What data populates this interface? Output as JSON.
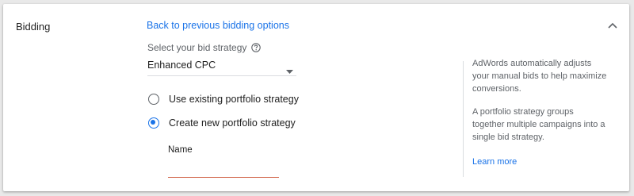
{
  "section": {
    "title": "Bidding"
  },
  "back_link": "Back to previous bidding options",
  "bid_strategy": {
    "label": "Select your bid strategy",
    "selected": "Enhanced CPC"
  },
  "portfolio_options": [
    {
      "label": "Use existing portfolio strategy",
      "checked": false
    },
    {
      "label": "Create new portfolio strategy",
      "checked": true
    }
  ],
  "name_field": {
    "label": "Name",
    "value": ""
  },
  "side_help": {
    "paragraph1": "AdWords automatically adjusts your manual bids to help maximize conversions.",
    "paragraph2": "A portfolio strategy groups together multiple campaigns into a single bid strategy.",
    "learn_more": "Learn more"
  },
  "colors": {
    "link": "#1a73e8",
    "error_underline": "#d2664a"
  },
  "icons": {
    "collapse": "chevron-up-icon",
    "help": "help-circle-icon",
    "dropdown": "caret-down-icon"
  }
}
